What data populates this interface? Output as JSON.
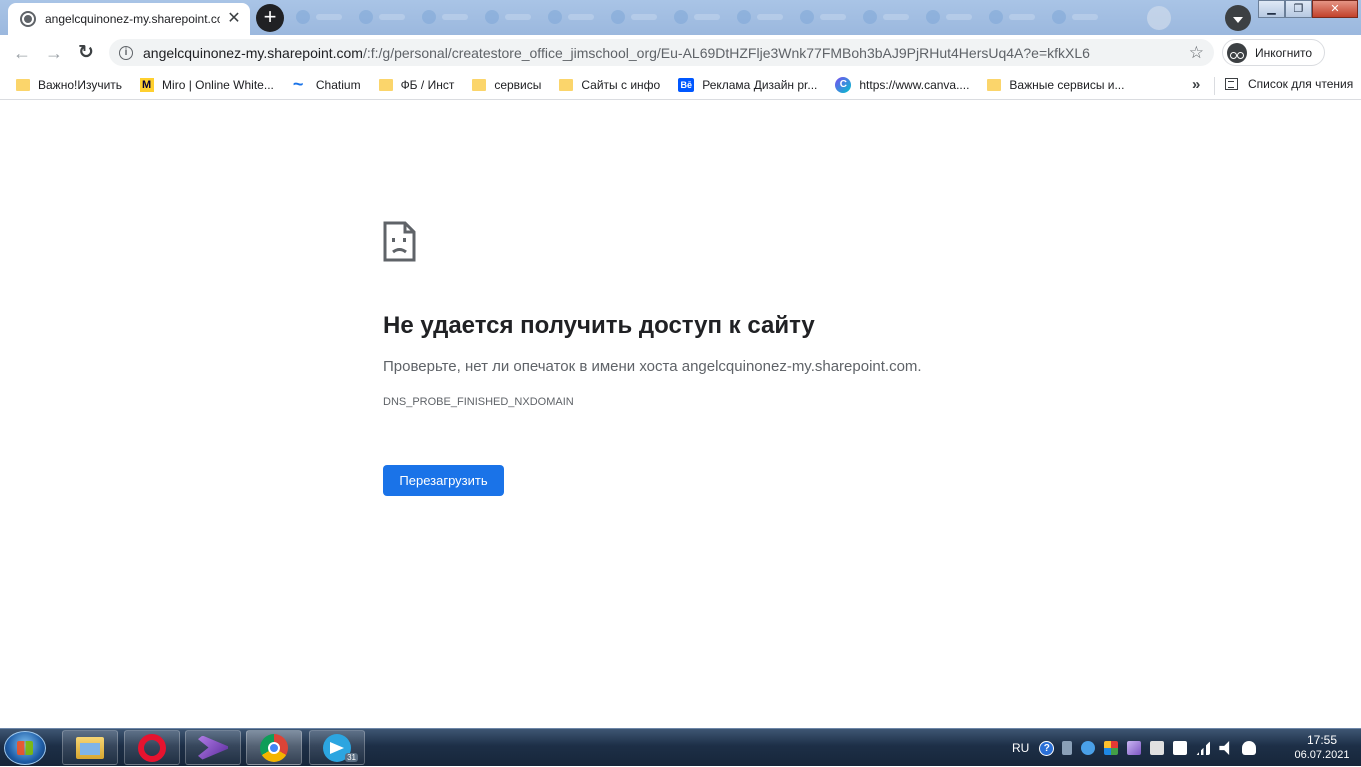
{
  "browser": {
    "tab": {
      "title": "angelcquinonez-my.sharepoint.com",
      "close_glyph": "✕",
      "icon": "globe-icon"
    },
    "new_tab_glyph": "+",
    "window_controls": {
      "minimize": "▁",
      "maximize": "❐",
      "close": "✕"
    },
    "toolbar": {
      "back_glyph": "←",
      "forward_glyph": "→",
      "reload_glyph": "↻",
      "url_host": "angelcquinonez-my.sharepoint.com",
      "url_path": "/:f:/g/personal/createstore_office_jimschool_org/Eu-AL69DtHZFlje3Wnk77FMBoh3bAJ9PjRHut4HersUq4A?e=kfkXL6",
      "info_glyph": "i",
      "star_glyph": "☆",
      "incognito_label": "Инкогнито"
    },
    "bookmarks": [
      {
        "label": "Важно!Изучить",
        "icon": "folder-icon"
      },
      {
        "label": "Miro | Online White...",
        "icon": "miro-icon"
      },
      {
        "label": "Chatium",
        "icon": "chatium-icon"
      },
      {
        "label": "ФБ / Инст",
        "icon": "folder-icon"
      },
      {
        "label": "сервисы",
        "icon": "folder-icon"
      },
      {
        "label": "Сайты с инфо",
        "icon": "folder-icon"
      },
      {
        "label": "Реклама Дизайн pr...",
        "icon": "behance-icon"
      },
      {
        "label": "https://www.canva....",
        "icon": "canva-icon"
      },
      {
        "label": "Важные сервисы и...",
        "icon": "folder-icon"
      }
    ],
    "bookmarks_more_glyph": "»",
    "reading_list_label": "Список для чтения",
    "behance_glyph": "Bē",
    "canva_glyph": "C"
  },
  "error_page": {
    "title": "Не удается получить доступ к сайту",
    "description": "Проверьте, нет ли опечаток в имени хоста angelcquinonez-my.sharepoint.com.",
    "error_code": "DNS_PROBE_FINISHED_NXDOMAIN",
    "reload_button": "Перезагрузить"
  },
  "taskbar": {
    "apps": [
      "explorer-icon",
      "opera-icon",
      "visual-studio-icon",
      "chrome-icon",
      "telegram-icon"
    ],
    "telegram_badge": "31",
    "language": "RU",
    "help_glyph": "?",
    "time": "17:55",
    "date": "06.07.2021"
  },
  "colors": {
    "accent": "#1a73e8",
    "tabstrip": "#a9c4e6",
    "taskbar": "#1d2f47"
  }
}
